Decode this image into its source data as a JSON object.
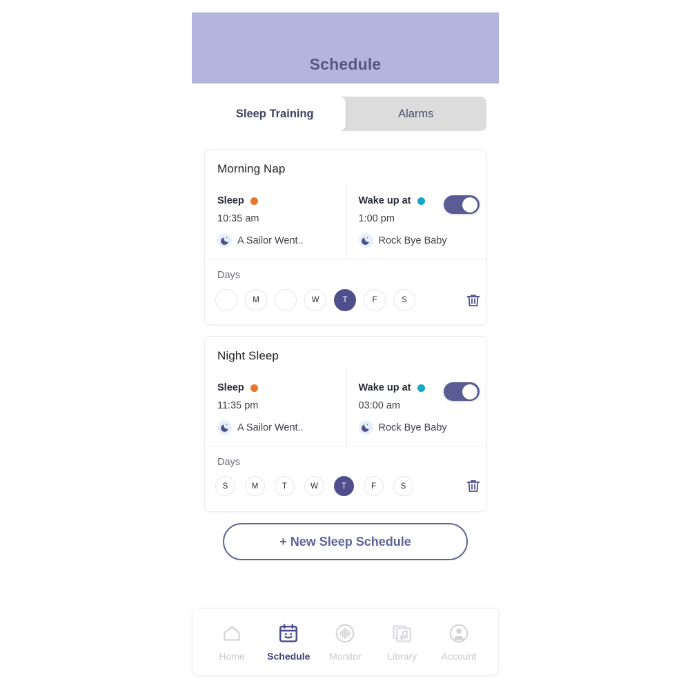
{
  "header": {
    "title": "Schedule"
  },
  "tabs": [
    {
      "label": "Sleep Training",
      "active": true
    },
    {
      "label": "Alarms",
      "active": false
    }
  ],
  "colors": {
    "header_bg": "#b3b5de",
    "accent": "#5f619b",
    "selected_day": "#4e4f8c",
    "sleep_dot": "#e8762c",
    "wake_dot": "#14a8c4",
    "toggle_on": "#5a5c96",
    "tab_track": "#dcdcdc"
  },
  "schedules": [
    {
      "title": "Morning Nap",
      "enabled": true,
      "sleep": {
        "label": "Sleep",
        "time": "10:35 am",
        "sound": "A Sailor Went..",
        "sound_icon": "moon-icon"
      },
      "wake": {
        "label": "Wake up at",
        "time": "1:00 pm",
        "sound": "Rock Bye Baby",
        "sound_icon": "moon-icon"
      },
      "days_label": "Days",
      "days": [
        {
          "letter": "",
          "selected": false
        },
        {
          "letter": "M",
          "selected": false
        },
        {
          "letter": "",
          "selected": false
        },
        {
          "letter": "W",
          "selected": false
        },
        {
          "letter": "T",
          "selected": true
        },
        {
          "letter": "F",
          "selected": false
        },
        {
          "letter": "S",
          "selected": false
        }
      ],
      "delete_icon": "trash-icon"
    },
    {
      "title": "Night Sleep",
      "enabled": true,
      "sleep": {
        "label": "Sleep",
        "time": "11:35 pm",
        "sound": "A Sailor Went..",
        "sound_icon": "moon-icon"
      },
      "wake": {
        "label": "Wake up at",
        "time": "03:00 am",
        "sound": "Rock Bye Baby",
        "sound_icon": "moon-icon"
      },
      "days_label": "Days",
      "days": [
        {
          "letter": "S",
          "selected": false
        },
        {
          "letter": "M",
          "selected": false
        },
        {
          "letter": "T",
          "selected": false
        },
        {
          "letter": "W",
          "selected": false
        },
        {
          "letter": "T",
          "selected": true
        },
        {
          "letter": "F",
          "selected": false
        },
        {
          "letter": "S",
          "selected": false
        }
      ],
      "delete_icon": "trash-icon"
    }
  ],
  "new_schedule_button": {
    "label": "+ New Sleep Schedule"
  },
  "bottom_nav": [
    {
      "label": "Home",
      "icon": "home-icon",
      "active": false
    },
    {
      "label": "Schedule",
      "icon": "calendar-smiley-icon",
      "active": true
    },
    {
      "label": "Monitor",
      "icon": "waveform-circle-icon",
      "active": false
    },
    {
      "label": "Library",
      "icon": "music-library-icon",
      "active": false
    },
    {
      "label": "Account",
      "icon": "account-circle-icon",
      "active": false
    }
  ]
}
